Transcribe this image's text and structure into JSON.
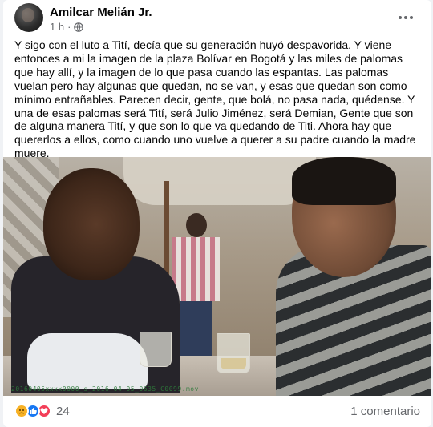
{
  "post": {
    "author": "Amilcar Melián Jr.",
    "time": "1 h",
    "separator": "·",
    "text": "Y sigo con el luto a Tití, decía que su generación huyó despavorida. Y viene entonces a mi la imagen de la plaza Bolívar en Bogotá y las miles de palomas que hay allí, y la imagen de lo que pasa cuando las espantas. Las palomas vuelan pero hay algunas que quedan, no se van, y esas que quedan son como mínimo entrañables. Parecen decir, gente, que bolá, no pasa nada, quédense. Y una de esas palomas será Tití, será Julio Jiménez, será Demian, Gente que son de alguna manera Tití, y que son lo que va quedando de Titi. Ahora hay que quererlos a ellos, como cuando uno vuelve a querer a su padre cuando la madre muere.",
    "photo_timecode": "20160405xxxx0000_s_2016-04-05_0635_C0099.mov",
    "reaction_count": "24",
    "comments_label": "1 comentario",
    "reaction_icons": [
      "sad-reaction",
      "like-reaction",
      "love-reaction"
    ]
  },
  "colors": {
    "text": "#050505",
    "secondary": "#65676b",
    "like": "#1877f2",
    "love": "#f33e58",
    "sad": "#f7b125"
  }
}
